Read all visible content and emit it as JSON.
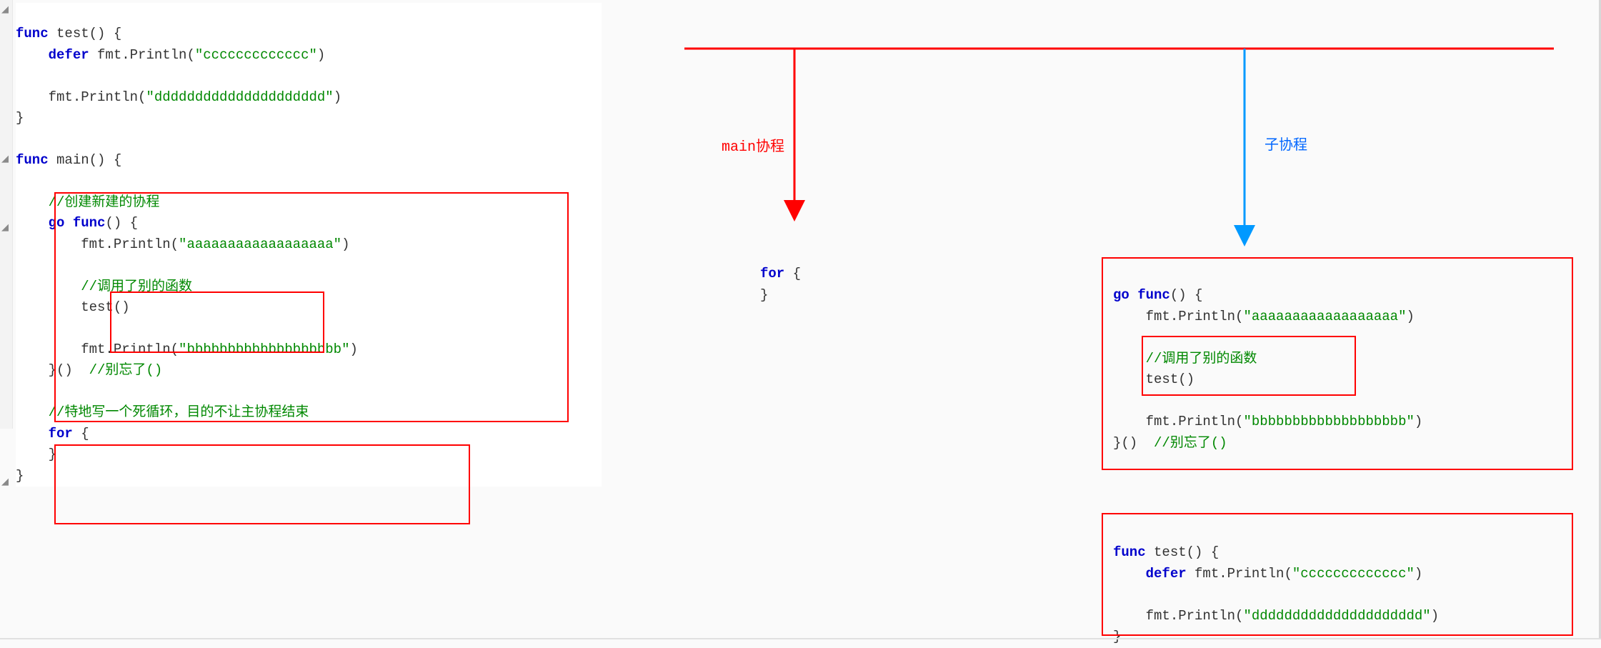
{
  "leftCode": {
    "l1_func": "func",
    "l1_rest": " test() {",
    "l2_defer": "defer",
    "l2_call": " fmt.Println(",
    "l2_str": "\"ccccccccccccc\"",
    "l2_end": ")",
    "l4_call": "fmt.Println(",
    "l4_str": "\"ddddddddddddddddddddd\"",
    "l4_end": ")",
    "l5": "}",
    "l7_func": "func",
    "l7_rest": " main() {",
    "l9_cmt": "//创建新建的协程",
    "l10_go": "go",
    "l10_func": " func",
    "l10_rest": "() {",
    "l11_call": "fmt.Println(",
    "l11_str": "\"aaaaaaaaaaaaaaaaaa\"",
    "l11_end": ")",
    "l13_cmt": "//调用了别的函数",
    "l14": "test()",
    "l16_call": "fmt.Println(",
    "l16_str": "\"bbbbbbbbbbbbbbbbbbb\"",
    "l16_end": ")",
    "l17a": "}()  ",
    "l17_cmt": "//别忘了()",
    "l19_cmt": "//特地写一个死循环，目的不让主协程结束",
    "l20_for": "for",
    "l20_rest": " {",
    "l21": "}",
    "l22": "}"
  },
  "labels": {
    "main": "main协程",
    "sub": "子协程"
  },
  "midCode": {
    "for": "for",
    "brace_open": " {",
    "brace_close": "}"
  },
  "rightCode1": {
    "l1_go": "go",
    "l1_func": " func",
    "l1_rest": "() {",
    "l2_call": "fmt.Println(",
    "l2_str": "\"aaaaaaaaaaaaaaaaaa\"",
    "l2_end": ")",
    "l4_cmt": "//调用了别的函数",
    "l5": "test()",
    "l7_call": "fmt.Println(",
    "l7_str": "\"bbbbbbbbbbbbbbbbbbb\"",
    "l7_end": ")",
    "l8a": "}()  ",
    "l8_cmt": "//别忘了()"
  },
  "rightCode2": {
    "l1_func": "func",
    "l1_rest": " test() {",
    "l2_defer": "defer",
    "l2_call": " fmt.Println(",
    "l2_str": "\"ccccccccccccc\"",
    "l2_end": ")",
    "l4_call": "fmt.Println(",
    "l4_str": "\"ddddddddddddddddddddd\"",
    "l4_end": ")",
    "l5": "}"
  }
}
